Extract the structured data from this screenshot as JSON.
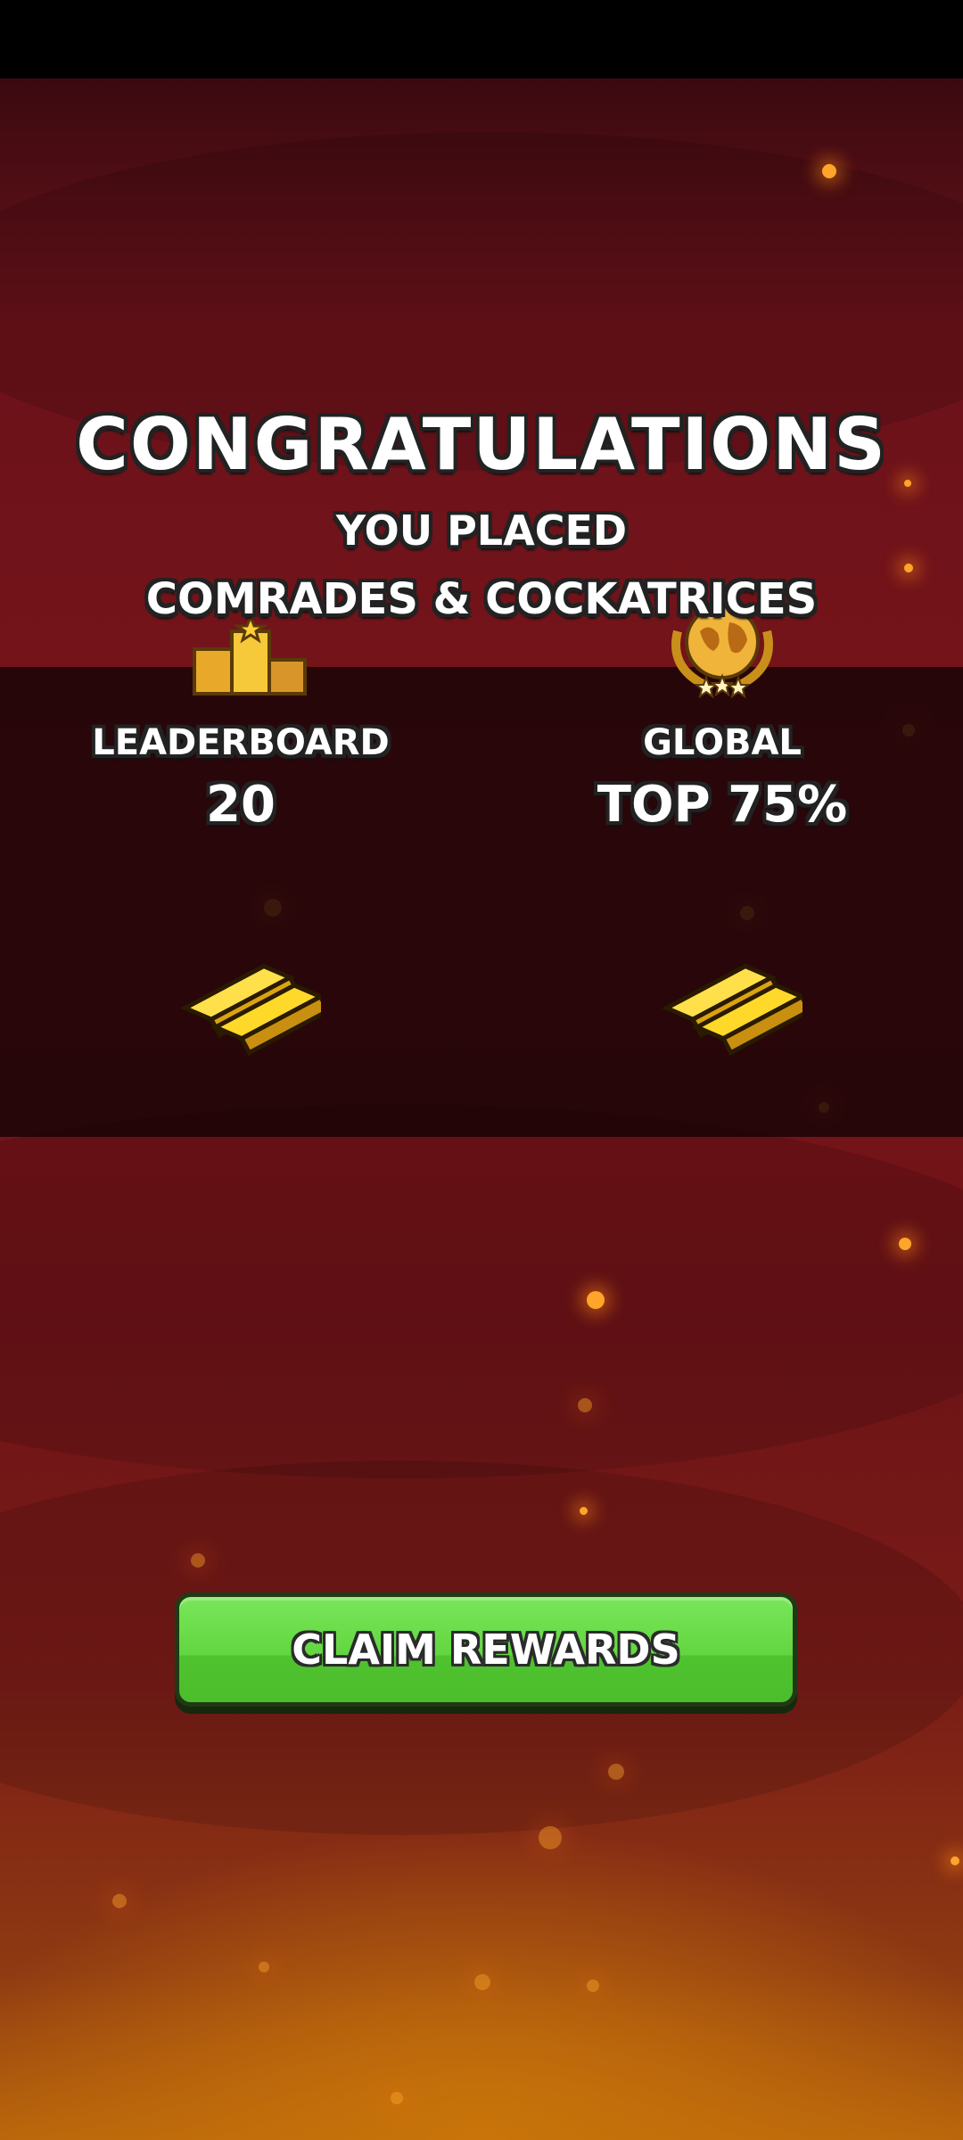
{
  "header": {
    "title": "CONGRATULATIONS",
    "subtitle": "YOU PLACED",
    "event_name": "COMRADES & COCKATRICES"
  },
  "results": {
    "leaderboard": {
      "label": "LEADERBOARD",
      "value": "20",
      "icon": "leaderboard-podium-icon",
      "reward_icon": "gold-bars-icon"
    },
    "global": {
      "label": "GLOBAL",
      "value": "TOP 75%",
      "icon": "globe-laurel-icon",
      "reward_icon": "gold-bars-icon"
    }
  },
  "claim_button": {
    "label": "CLAIM REWARDS",
    "color": "#62d640"
  },
  "colors": {
    "background_top": "#6b121a",
    "background_bottom": "#b8650c",
    "gold": "#f2c419",
    "ember": "#ffa52a"
  }
}
